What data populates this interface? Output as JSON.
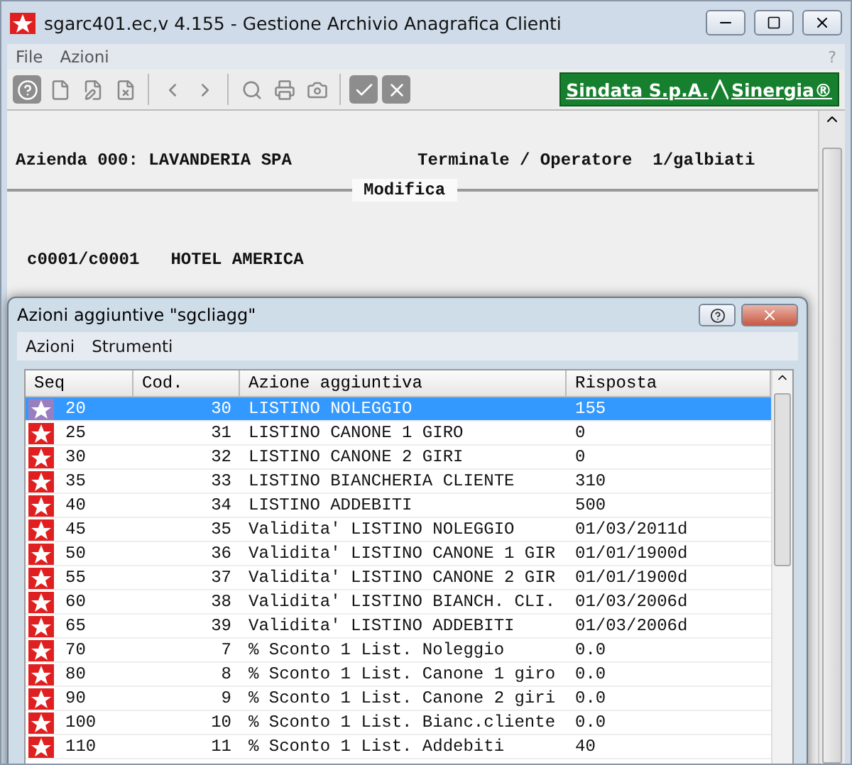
{
  "window": {
    "title": "sgarc401.ec,v 4.155 - Gestione Archivio Anagrafica Clienti",
    "help_mark": "?"
  },
  "menu": [
    "File",
    "Azioni"
  ],
  "logo": {
    "company": "Sindata S.p.A.",
    "product": "Sinergia®"
  },
  "header": {
    "company": "Azienda 000: LAVANDERIA SPA",
    "terminal": "Terminale / Operatore  1/galbiati",
    "mode": "Modifica",
    "customer_code": "c0001/c0001",
    "customer_name": "HOTEL AMERICA"
  },
  "dialog": {
    "title": "Azioni aggiuntive \"sgcliagg\"",
    "menu": [
      "Azioni",
      "Strumenti"
    ],
    "columns": [
      "Seq",
      "Cod.",
      "Azione aggiuntiva",
      "Risposta"
    ],
    "rows": [
      {
        "seq": "20",
        "cod": "30",
        "action": "LISTINO NOLEGGIO",
        "answer": "155",
        "selected": true
      },
      {
        "seq": "25",
        "cod": "31",
        "action": "LISTINO CANONE 1 GIRO",
        "answer": "0",
        "selected": false
      },
      {
        "seq": "30",
        "cod": "32",
        "action": "LISTINO CANONE 2 GIRI",
        "answer": "0",
        "selected": false
      },
      {
        "seq": "35",
        "cod": "33",
        "action": "LISTINO BIANCHERIA CLIENTE",
        "answer": "310",
        "selected": false
      },
      {
        "seq": "40",
        "cod": "34",
        "action": "LISTINO ADDEBITI",
        "answer": "500",
        "selected": false
      },
      {
        "seq": "45",
        "cod": "35",
        "action": "Validita' LISTINO NOLEGGIO",
        "answer": "01/03/2011d",
        "selected": false
      },
      {
        "seq": "50",
        "cod": "36",
        "action": "Validita' LISTINO CANONE 1 GIR",
        "answer": "01/01/1900d",
        "selected": false
      },
      {
        "seq": "55",
        "cod": "37",
        "action": "Validita' LISTINO CANONE 2 GIR",
        "answer": "01/01/1900d",
        "selected": false
      },
      {
        "seq": "60",
        "cod": "38",
        "action": "Validita' LISTINO BIANCH. CLI.",
        "answer": "01/03/2006d",
        "selected": false
      },
      {
        "seq": "65",
        "cod": "39",
        "action": "Validita' LISTINO ADDEBITI",
        "answer": "01/03/2006d",
        "selected": false
      },
      {
        "seq": "70",
        "cod": "7",
        "action": "% Sconto 1 List. Noleggio",
        "answer": "0.0",
        "selected": false
      },
      {
        "seq": "80",
        "cod": "8",
        "action": "% Sconto 1 List. Canone 1 giro",
        "answer": "0.0",
        "selected": false
      },
      {
        "seq": "90",
        "cod": "9",
        "action": "% Sconto 1 List. Canone 2 giri",
        "answer": "0.0",
        "selected": false
      },
      {
        "seq": "100",
        "cod": "10",
        "action": "% Sconto 1 List. Bianc.cliente",
        "answer": "0.0",
        "selected": false
      },
      {
        "seq": "110",
        "cod": "11",
        "action": "% Sconto 1 List. Addebiti",
        "answer": "40",
        "selected": false
      }
    ]
  }
}
